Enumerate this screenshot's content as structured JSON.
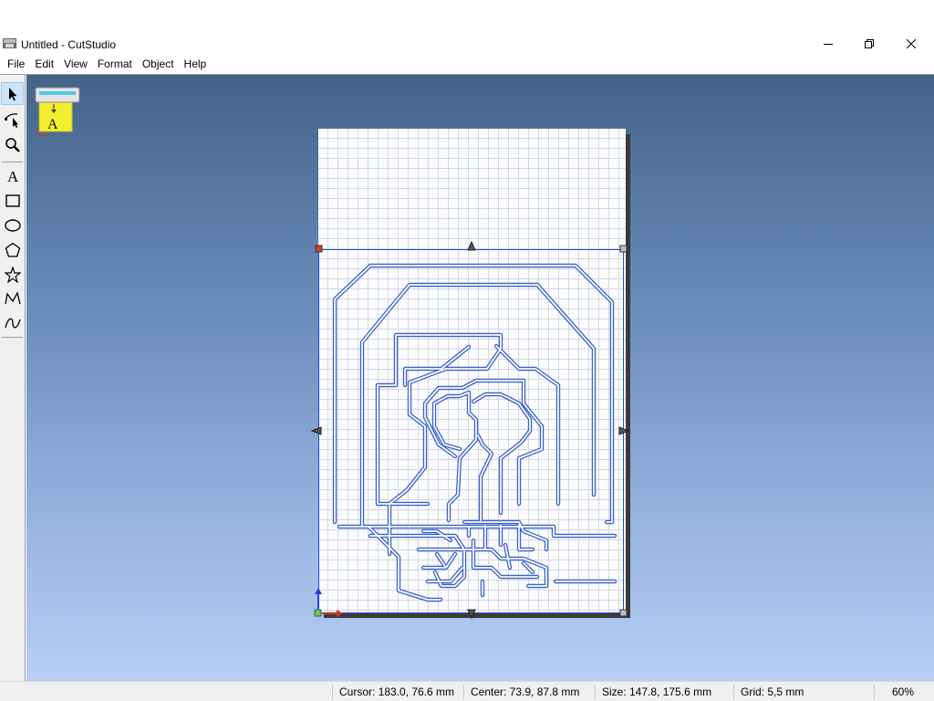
{
  "window": {
    "title": "Untitled - CutStudio",
    "controls": {
      "minimize": "minimize-icon",
      "maximize": "restore-icon",
      "close": "close-icon"
    }
  },
  "menu": [
    "File",
    "Edit",
    "View",
    "Format",
    "Object",
    "Help"
  ],
  "toolbar": {
    "tools": [
      {
        "name": "select-tool",
        "icon": "arrow-pointer-icon",
        "active": true
      },
      {
        "name": "node-edit-tool",
        "icon": "node-edit-icon",
        "active": false
      },
      {
        "name": "zoom-tool",
        "icon": "magnifier-icon",
        "active": false
      },
      {
        "name": "text-tool",
        "icon": "text-a-icon",
        "active": false
      },
      {
        "name": "rectangle-tool",
        "icon": "rectangle-icon",
        "active": false
      },
      {
        "name": "ellipse-tool",
        "icon": "ellipse-icon",
        "active": false
      },
      {
        "name": "polygon-tool",
        "icon": "pentagon-icon",
        "active": false
      },
      {
        "name": "star-tool",
        "icon": "star-icon",
        "active": false
      },
      {
        "name": "polyline-tool",
        "icon": "polyline-icon",
        "active": false
      },
      {
        "name": "curve-tool",
        "icon": "curve-icon",
        "active": false
      }
    ]
  },
  "canvas": {
    "cutter_icon": "cutting-machine-icon",
    "cutter_label": "A",
    "colors": {
      "trace": "#3a63c9",
      "selection": "#1f4fd0",
      "page_grid": "#d3d8e0"
    }
  },
  "status": {
    "cursor": "Cursor: 183.0, 76.6 mm",
    "center": "Center: 73.9, 87.8 mm",
    "size": "Size: 147.8, 175.6 mm",
    "grid": "Grid: 5,5 mm",
    "zoom": "60%"
  }
}
